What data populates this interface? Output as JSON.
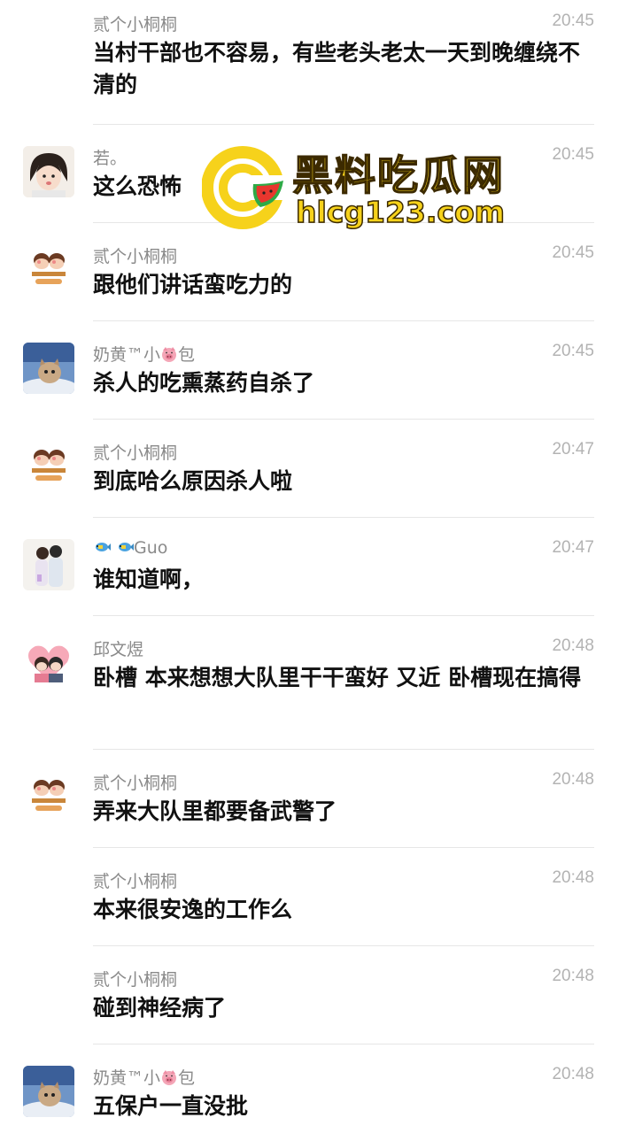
{
  "messages": [
    {
      "sender": "贰个小桐桐",
      "time": "20:45",
      "text": "当村干部也不容易，有些老头老太一天到晚缠绕不清的",
      "avatar": "none"
    },
    {
      "sender": "若。",
      "time": "20:45",
      "text": "这么恐怖",
      "avatar": "girl-avatar"
    },
    {
      "sender": "贰个小桐桐",
      "time": "20:45",
      "text": "跟他们讲话蛮吃力的",
      "avatar": "cartoon-couple-avatar"
    },
    {
      "sender": "奶黄™小",
      "sender_suffix": "包",
      "time": "20:45",
      "text": "杀人的吃熏蒸药自杀了",
      "avatar": "cat-avatar"
    },
    {
      "sender": "贰个小桐桐",
      "time": "20:47",
      "text": "到底哈么原因杀人啦",
      "avatar": "cartoon-couple-avatar"
    },
    {
      "sender": "Guo",
      "time": "20:47",
      "text": "谁知道啊，",
      "avatar": "couple-photo-avatar"
    },
    {
      "sender": "邱文煜",
      "time": "20:48",
      "text": "卧槽 本来想想大队里干干蛮好 又近 卧槽现在搞得",
      "avatar": "heart-couple-avatar"
    },
    {
      "sender": "贰个小桐桐",
      "time": "20:48",
      "text": "弄来大队里都要备武警了",
      "avatar": "cartoon-couple-avatar"
    },
    {
      "sender": "贰个小桐桐",
      "time": "20:48",
      "text": "本来很安逸的工作么",
      "avatar": "none"
    },
    {
      "sender": "贰个小桐桐",
      "time": "20:48",
      "text": "碰到神经病了",
      "avatar": "none"
    },
    {
      "sender": "奶黄™小",
      "sender_suffix": "包",
      "time": "20:48",
      "text": "五保户一直没批",
      "avatar": "cat-avatar"
    }
  ],
  "watermark": {
    "title": "黑料吃瓜网",
    "url": "hlcg123.com"
  },
  "colors": {
    "name": "#8a8a8a",
    "time": "#b3b3b3",
    "text": "#111111",
    "divider": "#e6e6e6",
    "watermark": "#f6d21b"
  }
}
